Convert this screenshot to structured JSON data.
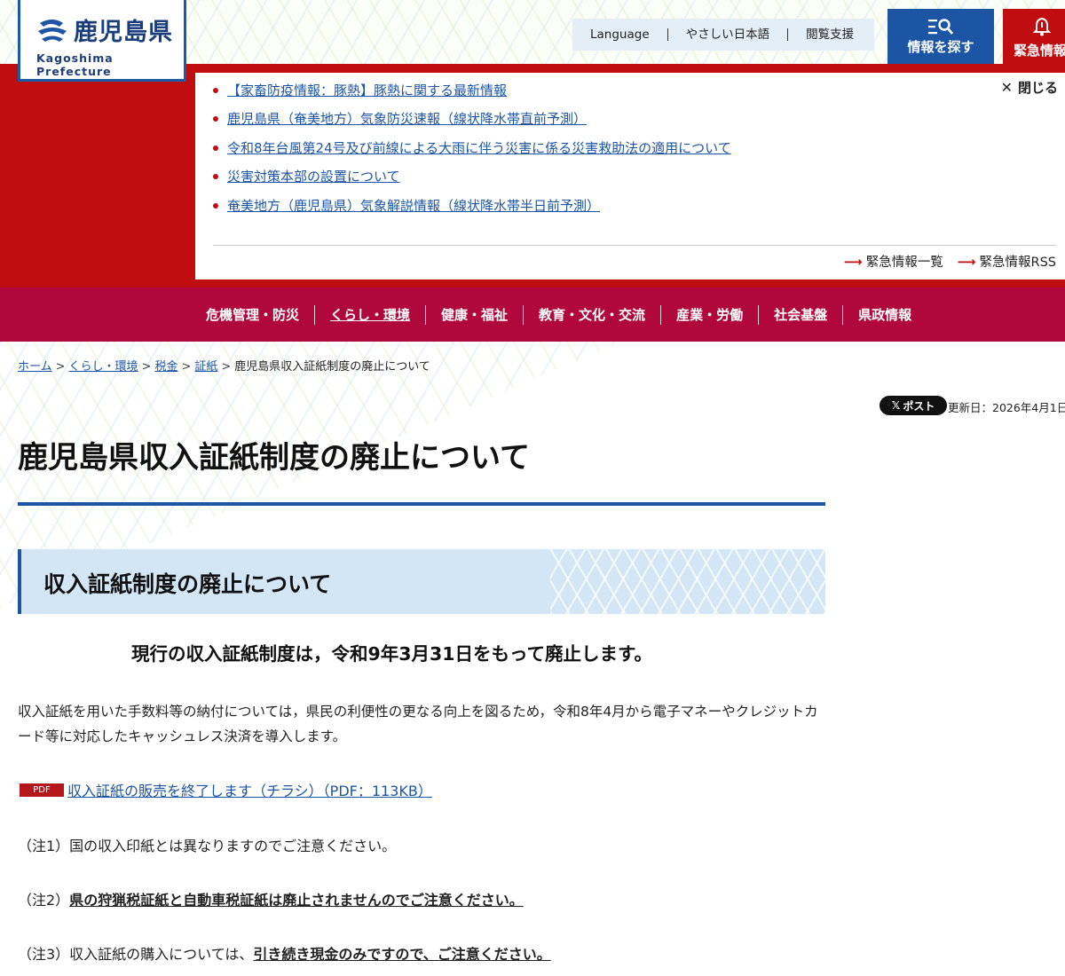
{
  "header": {
    "logo_jp": "鹿児島県",
    "logo_en": "Kagoshima Prefecture",
    "util_links": [
      "Language",
      "やさしい日本語",
      "閲覧支援"
    ],
    "search_button": "情報を探す",
    "emergency_button": "緊急情報"
  },
  "emergency": {
    "items": [
      "【家畜防疫情報：豚熱】豚熱に関する最新情報",
      "鹿児島県（奄美地方）気象防災速報（線状降水帯直前予測）",
      "令和8年台風第24号及び前線による大雨に伴う災害に係る災害救助法の適用について",
      "災害対策本部の設置について",
      "奄美地方（鹿児島県）気象解説情報（線状降水帯半日前予測）"
    ],
    "close_label": "閉じる",
    "list_link": "緊急情報一覧",
    "rss_link": "緊急情報RSS"
  },
  "nav": {
    "items": [
      "危機管理・防災",
      "くらし・環境",
      "健康・福祉",
      "教育・文化・交流",
      "産業・労働",
      "社会基盤",
      "県政情報"
    ],
    "active_index": 1
  },
  "breadcrumb": {
    "items": [
      "ホーム",
      "くらし・環境",
      "税金",
      "証紙"
    ],
    "current": "鹿児島県収入証紙制度の廃止について"
  },
  "meta": {
    "post_label": "ポスト",
    "updated": "更新日：2026年4月1日"
  },
  "content": {
    "title": "鹿児島県収入証紙制度の廃止について",
    "heading": "収入証紙制度の廃止について",
    "lead": "現行の収入証紙制度は，令和9年3月31日をもって廃止します。",
    "paragraph": "収入証紙を用いた手数料等の納付については，県民の利便性の更なる向上を図るため，令和8年4月から電子マネーやクレジットカード等に対応したキャッシュレス決済を導入します。",
    "pdf_badge": "PDF",
    "pdf_link": "収入証紙の販売を終了します（チラシ）（PDF：113KB）",
    "note1": "（注1）国の収入印紙とは異なりますのでご注意ください。",
    "note2_prefix": "（注2）",
    "note2_strong": "県の狩猟税証紙と自動車税証紙は廃止されませんのでご注意ください。",
    "note3_prefix": "（注3）収入証紙の購入については、",
    "note3_strong": "引き続き現金のみですので、ご注意ください。"
  },
  "colors": {
    "brand_blue": "#1b55a3",
    "emergency_red": "#c00d10",
    "nav_crimson": "#b0083c",
    "heading_bg": "#d3e6f6"
  }
}
